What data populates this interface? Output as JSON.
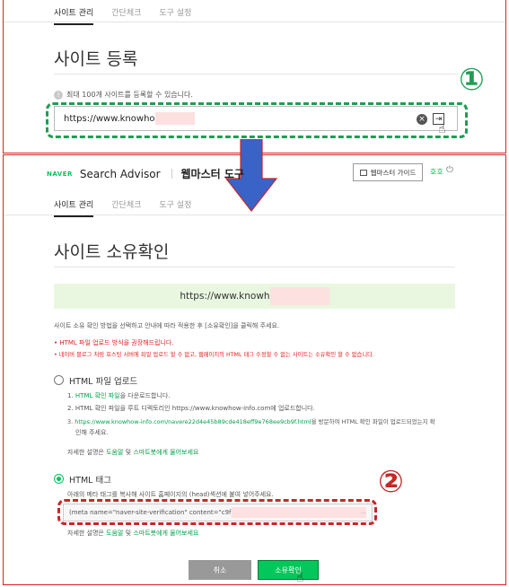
{
  "top_tabs": [
    "사이트 관리",
    "간단체크",
    "도구 설정"
  ],
  "register": {
    "title": "사이트 등록",
    "info": "최대 100개 사이트를 등록할 수 있습니다.",
    "url_value": "https://www.knowho"
  },
  "marker1": "①",
  "marker2": "②",
  "header": {
    "brand": "NAVER",
    "product": "Search Advisor",
    "subtitle": "웹마스터 도구",
    "guide_button": "웹마스터 가이드",
    "user": "호호"
  },
  "bottom_tabs": [
    "사이트 관리",
    "간단체크",
    "도구 설정"
  ],
  "verify": {
    "title": "사이트 소유확인",
    "url": "https://www.knowh",
    "instruction": "사이트 소유 확인 방법을 선택하고 안내에 따라 적용한 후 [소유확인]을 클릭해 주세요.",
    "warning1": "• HTML 파일 업로드 방식을 권장해드립니다.",
    "warning2": "• 네이버 블로그 처럼 호스팅 서버에 파일 업로드 할 수 없고, 웹페이지의 HTML 태그 수정할 수 없는 사이트는 소유확인 할 수 없습니다.",
    "option_file": "HTML 파일 업로드",
    "step1_prefix": "1. ",
    "step1_link": "HTML 확인 파일",
    "step1_suffix": "을 다운로드합니다.",
    "step2": "2. HTML 확인 파일을 루트 디렉토리인 https://www.knowhow-info.com에 업로드합니다.",
    "step3_prefix": "3. ",
    "step3_link": "https://www.knowhow-info.com/navere22d4e45b89cde418eff9e768ee9cb9f.html",
    "step3_suffix": "을 방문하여 HTML 확인 파일이 업로드되었는지 확",
    "step3_cont": "인해 주세요.",
    "help_prefix": "자세한 설명은 ",
    "help_link1": "도움말",
    "help_mid": " 및 ",
    "help_link2": "스마트봇에게 물어보세요",
    "option_tag": "HTML 태그",
    "tag_instruction": "아래의 메타 태그를 복사해 사이트 홈페이지의 (head)섹션에 붙여 넣어주세요.",
    "meta_value": "(meta name=\"naver-site-verification\" content=\"c9f",
    "meta_dots": "...",
    "cancel": "취소",
    "confirm": "소유확인"
  }
}
